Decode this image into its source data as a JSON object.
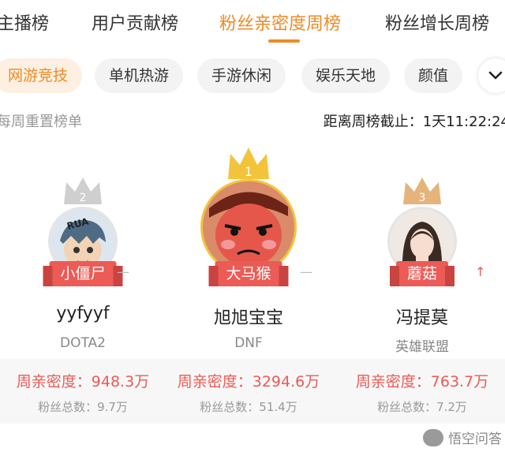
{
  "tabs": [
    {
      "label": "主播榜",
      "active": false
    },
    {
      "label": "用户贡献榜",
      "active": false
    },
    {
      "label": "粉丝亲密度周榜",
      "active": true
    },
    {
      "label": "粉丝增长周榜",
      "active": false
    }
  ],
  "chips": [
    {
      "label": "网游竞技",
      "active": true
    },
    {
      "label": "单机热游",
      "active": false
    },
    {
      "label": "手游休闲",
      "active": false
    },
    {
      "label": "娱乐天地",
      "active": false
    },
    {
      "label": "颜值",
      "active": false
    }
  ],
  "info": {
    "reset_note": "每周重置榜单",
    "countdown": "距离周榜截止：1天11:22:24"
  },
  "podium": [
    {
      "rank": "2",
      "badge": "小僵尸",
      "name": "yyfyyf",
      "game": "DOTA2",
      "trend": "—",
      "intimacy": "周亲密度：948.3万",
      "fans": "粉丝总数：9.7万",
      "avatar_text": "RUA"
    },
    {
      "rank": "1",
      "badge": "大马猴",
      "name": "旭旭宝宝",
      "game": "DNF",
      "trend": "—",
      "intimacy": "周亲密度：3294.6万",
      "fans": "粉丝总数：51.4万"
    },
    {
      "rank": "3",
      "badge": "蘑菇",
      "name": "冯提莫",
      "game": "英雄联盟",
      "trend": "↑",
      "intimacy": "周亲密度：763.7万",
      "fans": "粉丝总数：7.2万"
    }
  ],
  "watermark": {
    "text": "悟空问答"
  },
  "colors": {
    "accent": "#f08a25",
    "ribbon": "#ec5b55",
    "gold": "#f3c43b",
    "silver": "#cfcfcf",
    "bronze": "#e5b47b"
  }
}
